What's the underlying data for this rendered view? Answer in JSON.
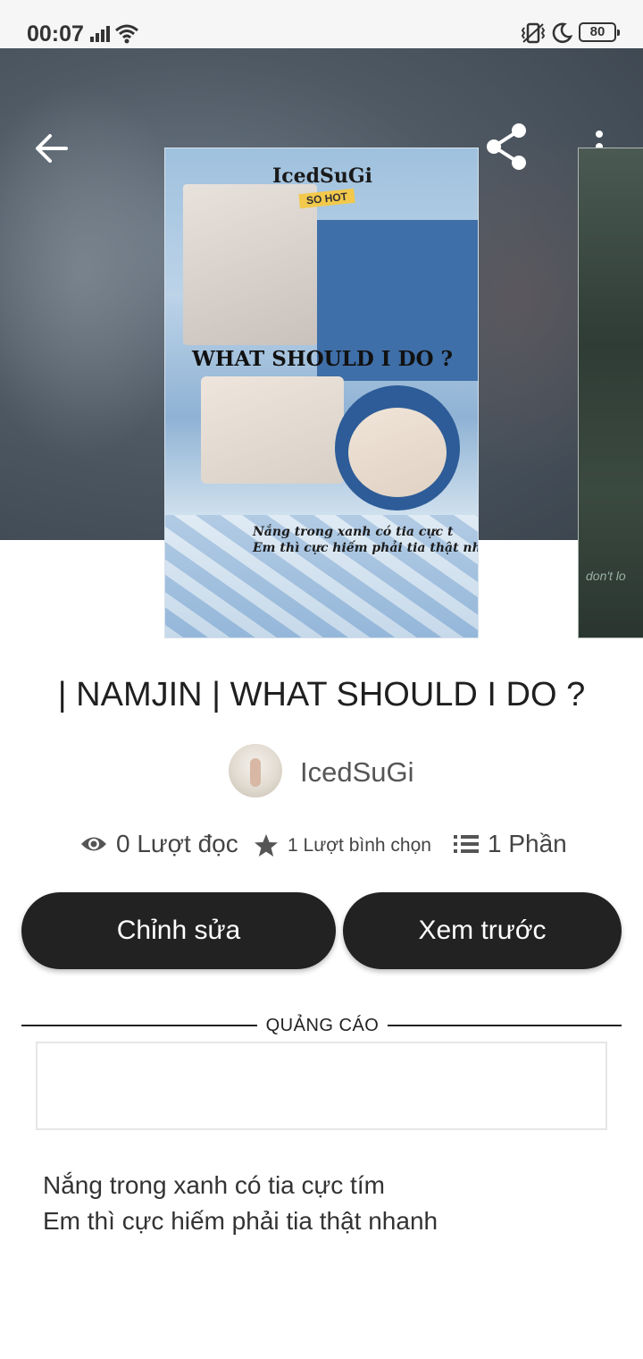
{
  "status_bar": {
    "time": "00:07",
    "battery": "80",
    "icons": [
      "signal-icon",
      "wifi-icon",
      "vibrate-icon",
      "moon-icon",
      "battery-icon"
    ]
  },
  "toolbar": {
    "icons": [
      "back-arrow-icon",
      "share-icon",
      "more-vertical-icon"
    ]
  },
  "cover": {
    "brand": "IcedSuGi",
    "tag": "SO HOT",
    "headline": "WHAT SHOULD I DO ?",
    "lyric_line_1": "Nắng trong xanh có tia cực t",
    "lyric_line_2": "Em thì cực hiếm phải tia thật nha",
    "next_cover_text": "don't lo"
  },
  "story": {
    "title": "| NAMJIN | WHAT SHOULD I DO ?",
    "author": "IcedSuGi"
  },
  "stats": {
    "reads": "0 Lượt đọc",
    "votes": "1 Lượt bình chọn",
    "parts": "1 Phần",
    "icons": [
      "eye-icon",
      "star-icon",
      "list-icon"
    ]
  },
  "actions": {
    "edit_label": "Chỉnh sửa",
    "preview_label": "Xem trước"
  },
  "ad": {
    "label": "QUẢNG CÁO"
  },
  "description": {
    "line_1": "Nắng trong xanh có tia cực tím",
    "line_2": "Em thì cực hiếm phải tia thật nhanh"
  },
  "colors": {
    "button_bg": "#222222",
    "button_text": "#ffffff",
    "hero_bg": "#4e5964",
    "text_primary": "#1f1f1f",
    "text_secondary": "#555555"
  }
}
